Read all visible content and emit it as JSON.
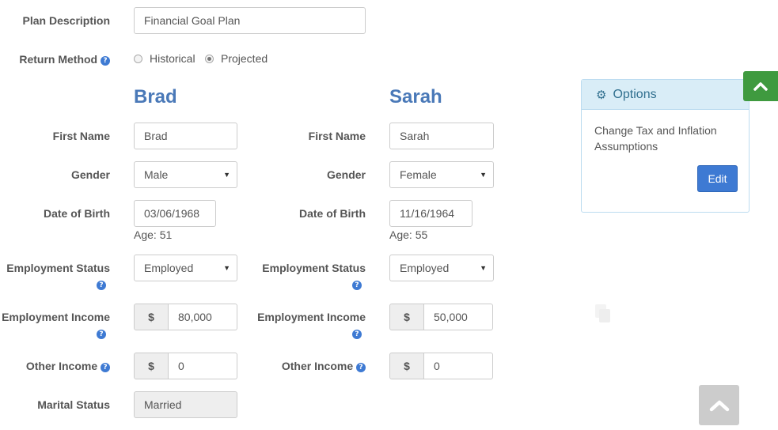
{
  "plan": {
    "description_label": "Plan Description",
    "description_value": "Financial Goal Plan",
    "return_method_label": "Return Method",
    "return_options": [
      "Historical",
      "Projected"
    ],
    "return_selected": "Projected"
  },
  "labels": {
    "first_name": "First Name",
    "gender": "Gender",
    "dob": "Date of Birth",
    "employment_status": "Employment Status",
    "employment_income": "Employment Income",
    "other_income": "Other Income",
    "marital_status": "Marital Status"
  },
  "persons": [
    {
      "heading": "Brad",
      "first_name": "Brad",
      "gender": "Male",
      "dob": "03/06/1968",
      "age": "Age: 51",
      "employment_status": "Employed",
      "currency": "$",
      "employment_income": "80,000",
      "other_income": "0"
    },
    {
      "heading": "Sarah",
      "first_name": "Sarah",
      "gender": "Female",
      "dob": "11/16/1964",
      "age": "Age: 55",
      "employment_status": "Employed",
      "currency": "$",
      "employment_income": "50,000",
      "other_income": "0"
    }
  ],
  "marital_status_value": "Married",
  "options": {
    "title": "Options",
    "text": "Change Tax and Inflation Assumptions",
    "edit_label": "Edit"
  },
  "icons": {
    "help": "question-circle-icon",
    "gear": "gear-icon",
    "scroll_up": "chevron-up-icon",
    "select": "caret-down-icon"
  },
  "colors": {
    "primary": "#3e7ad3",
    "name_heading": "#4a79b8",
    "panel_header": "#d9edf7",
    "scroll_green": "#3f9a3f",
    "scroll_grey": "#cccccc"
  }
}
